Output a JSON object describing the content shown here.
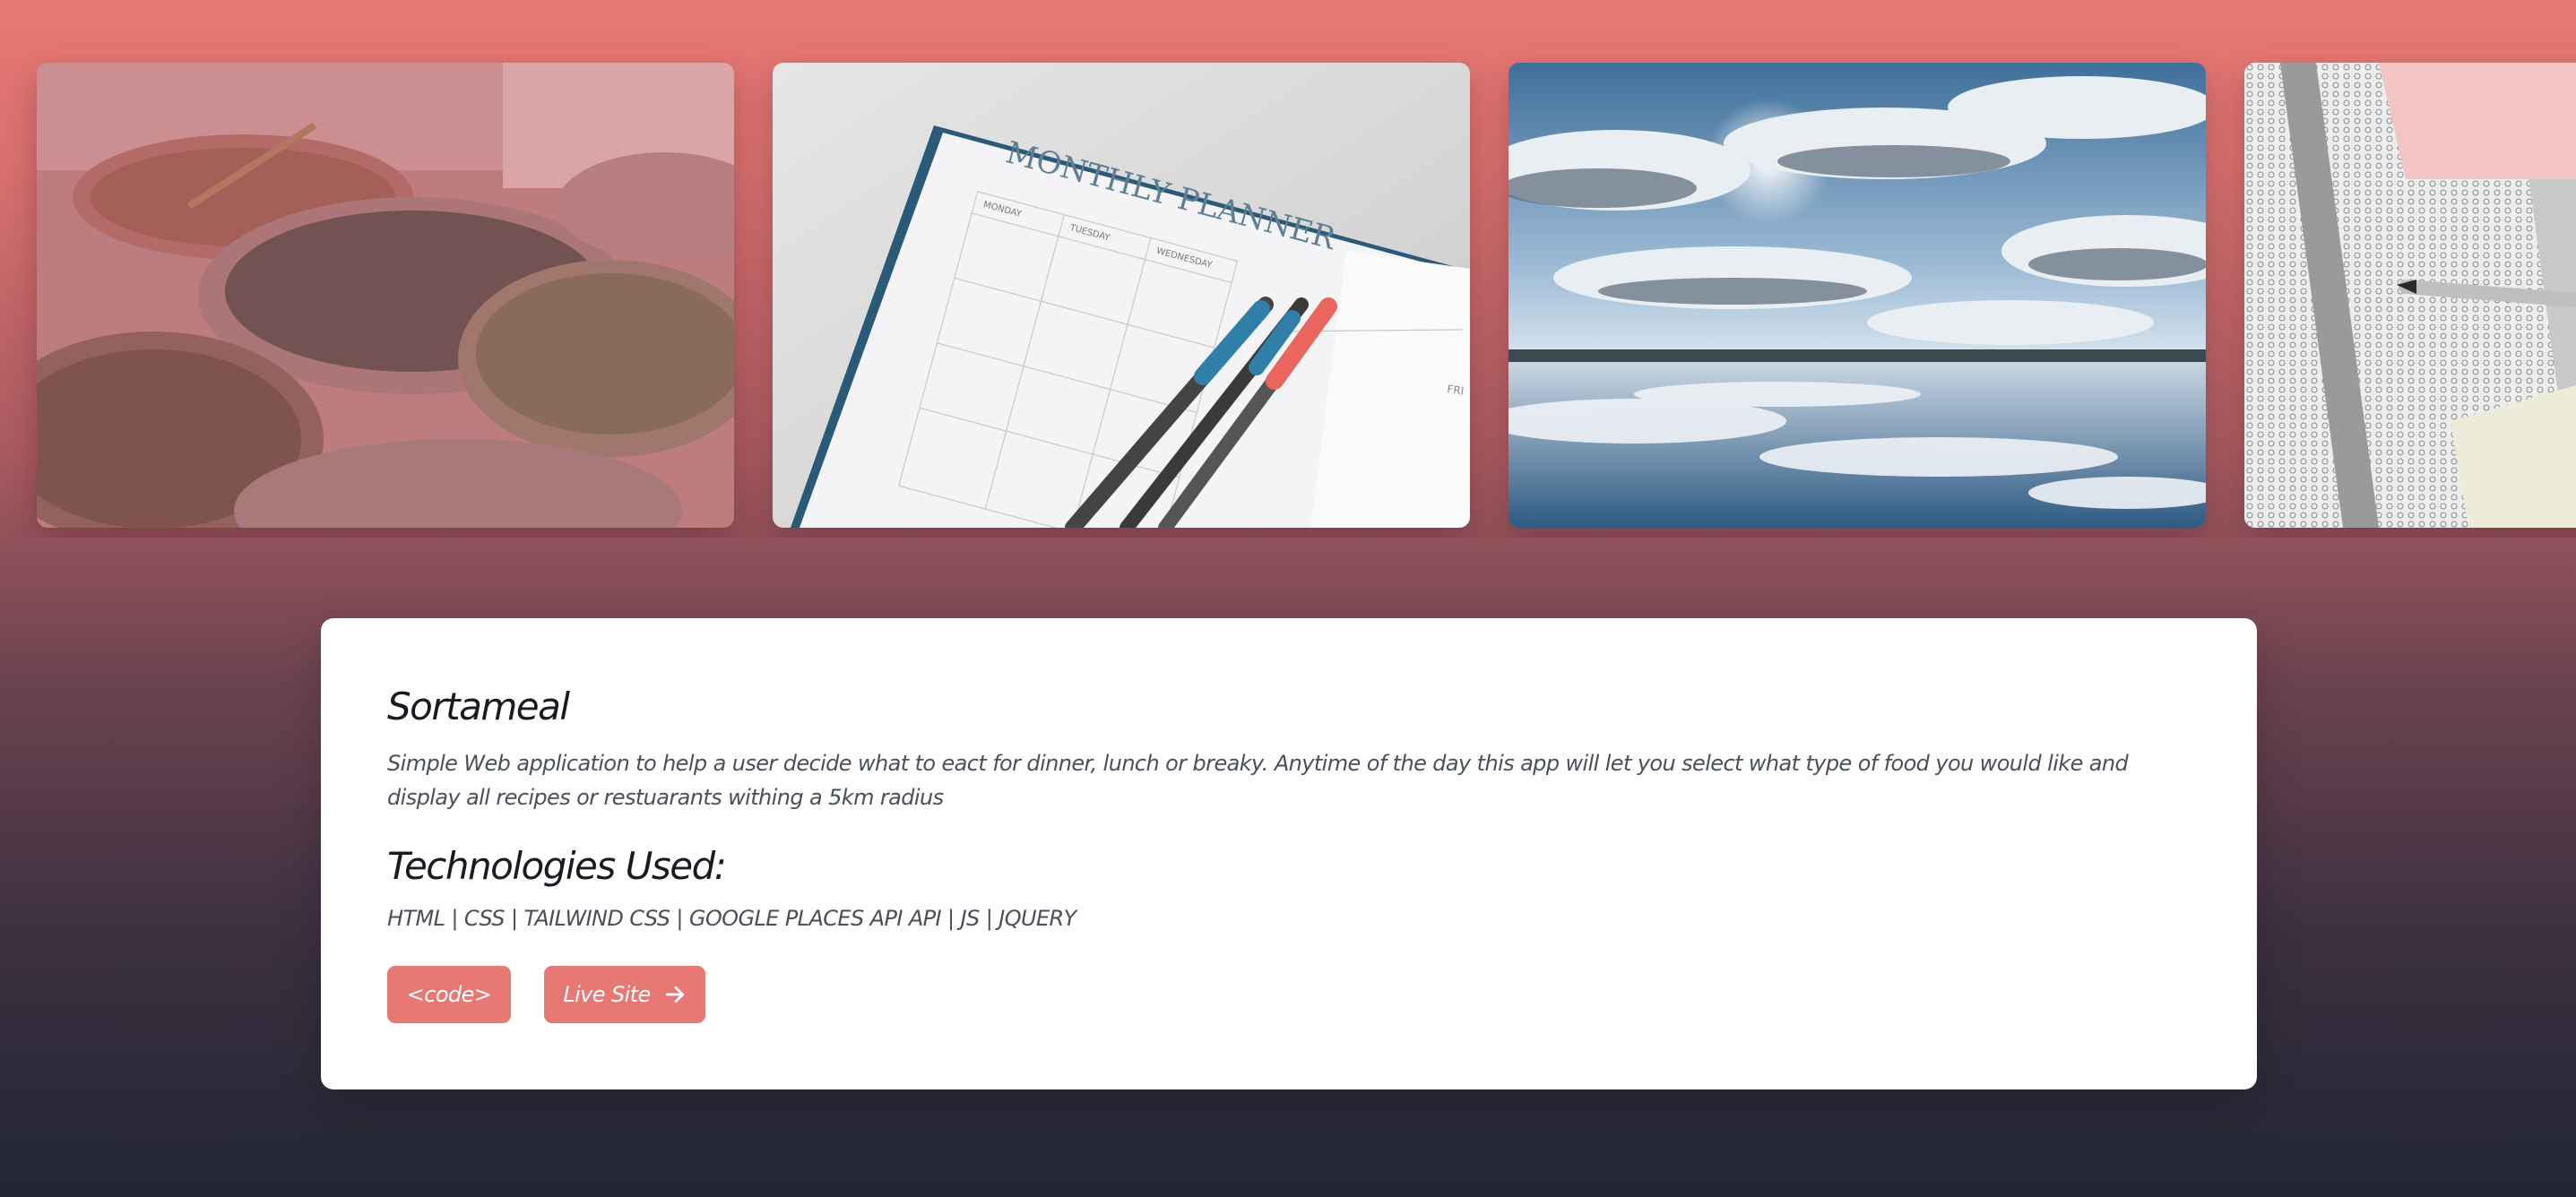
{
  "carousel": {
    "slides": [
      {
        "subject": "food-containers-image"
      },
      {
        "subject": "monthly-planner-image",
        "planner_title": "MONTHLY PLANNER",
        "days": [
          "MONDAY",
          "TUESDAY",
          "WEDNESDAY",
          "FRI"
        ]
      },
      {
        "subject": "sky-lake-image"
      },
      {
        "subject": "lottery-sheets-image"
      }
    ]
  },
  "project": {
    "title": "Sortameal",
    "description": "Simple Web application to help a user decide what to eact for dinner, lunch or breaky. Anytime of the day this app will let you select what type of food you would like and display all recipes or restuarants withing a 5km radius",
    "tech_heading": "Technologies Used:",
    "tech_list": "HTML | CSS | TAILWIND CSS | GOOGLE PLACES API API | JS | JQUERY",
    "code_button": "<code>",
    "live_button": "Live Site",
    "live_icon": "arrow-right-icon"
  },
  "colors": {
    "accent": "#e87874",
    "background_top": "#e87874",
    "background_bottom": "#222634",
    "card": "#ffffff"
  }
}
